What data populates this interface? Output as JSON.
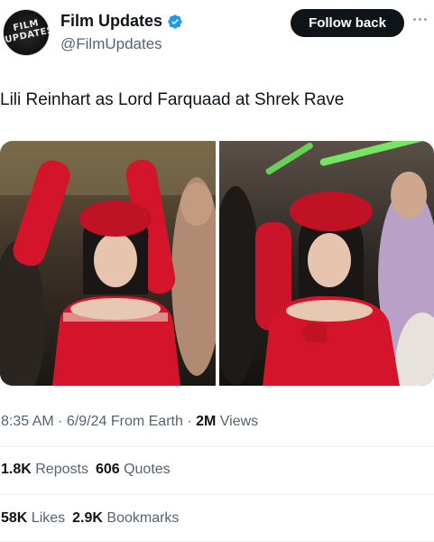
{
  "author": {
    "display_name": "Film Updates",
    "handle": "@FilmUpdates",
    "avatar_text_line1": "FILM",
    "avatar_text_line2": "UPDATES",
    "verified_color": "#1d9bf0"
  },
  "follow_button": {
    "label": "Follow back"
  },
  "more_icon": "more-horizontal-icon",
  "tweet": {
    "text": "Lili Reinhart as Lord Farquaad at Shrek Rave"
  },
  "media": {
    "count": 2
  },
  "meta": {
    "time": "8:35 AM",
    "sep1": " · ",
    "date": "6/9/24",
    "source": " From Earth",
    "sep2": " · ",
    "views_count": "2M",
    "views_label": " Views"
  },
  "stats_row1": {
    "reposts_count": "1.8K",
    "reposts_label": " Reposts",
    "quotes_count": "606",
    "quotes_label": " Quotes"
  },
  "stats_row2": {
    "likes_count": "58K",
    "likes_label": " Likes",
    "bookmarks_count": "2.9K",
    "bookmarks_label": " Bookmarks"
  },
  "colors": {
    "text_primary": "#0f1419",
    "text_secondary": "#536471",
    "button_bg": "#0f1419",
    "divider": "#eff3f4",
    "costume_red": "#d3142a"
  }
}
